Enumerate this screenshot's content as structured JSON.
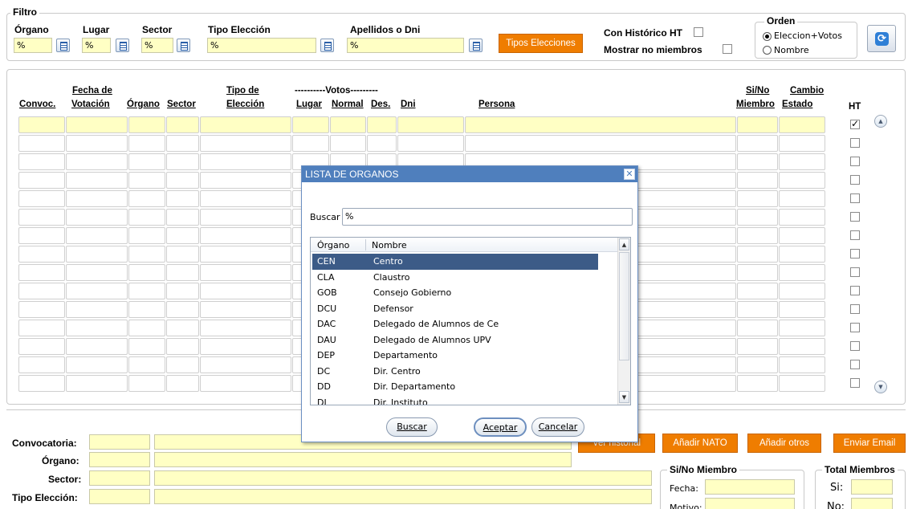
{
  "filter": {
    "legend": "Filtro",
    "organo": {
      "label": "Órgano",
      "value": "%"
    },
    "lugar": {
      "label": "Lugar",
      "value": "%"
    },
    "sector": {
      "label": "Sector",
      "value": "%"
    },
    "tipo_eleccion": {
      "label": "Tipo Elección",
      "value": "%"
    },
    "apellidos": {
      "label": "Apellidos o Dni",
      "value": "%"
    },
    "tipos_button": "Tipos Elecciones",
    "con_historico": "Con Histórico HT",
    "mostrar_no_miembros": "Mostrar no miembros"
  },
  "orden": {
    "legend": "Orden",
    "opt1": "Eleccion+Votos",
    "opt2": "Nombre",
    "selected": "Eleccion+Votos"
  },
  "grid": {
    "headers": {
      "convoc": "Convoc.",
      "fecha_1": "Fecha de",
      "fecha_2": "Votación",
      "organo": "Órgano",
      "sector": "Sector",
      "tipo_1": "Tipo de",
      "tipo_2": "Elección",
      "votos_group": "----------Votos---------",
      "lugar": "Lugar",
      "normal": "Normal",
      "des": "Des.",
      "dni": "Dni",
      "persona": "Persona",
      "sino_1": "Si/No",
      "sino_2": "Miembro",
      "cambio_1": "Cambio",
      "cambio_2": "Estado",
      "ht": "HT"
    },
    "row_count": 15,
    "first_row_ht_checked": true
  },
  "dialog": {
    "title": "LISTA DE ORGANOS",
    "search_label": "Buscar",
    "search_value": "%",
    "col_organo": "Órgano",
    "col_nombre": "Nombre",
    "rows": [
      {
        "code": "CEN",
        "name": "Centro",
        "selected": true
      },
      {
        "code": "CLA",
        "name": "Claustro"
      },
      {
        "code": "GOB",
        "name": "Consejo Gobierno"
      },
      {
        "code": "DCU",
        "name": "Defensor"
      },
      {
        "code": "DAC",
        "name": "Delegado de Alumnos de Ce"
      },
      {
        "code": "DAU",
        "name": "Delegado de Alumnos UPV"
      },
      {
        "code": "DEP",
        "name": "Departamento"
      },
      {
        "code": "DC",
        "name": "Dir. Centro"
      },
      {
        "code": "DD",
        "name": "Dir. Departamento"
      },
      {
        "code": "DI",
        "name": "Dir. Instituto"
      }
    ],
    "btn_buscar": "Buscar",
    "btn_aceptar": "Aceptar",
    "btn_cancelar": "Cancelar"
  },
  "detail": {
    "convocatoria": "Convocatoria:",
    "organo": "Órgano:",
    "sector": "Sector:",
    "tipo_eleccion": "Tipo Elección:",
    "btn_historial": "Ver historial",
    "btn_nato": "Añadir NATO",
    "btn_otros": "Añadir otros",
    "btn_email": "Enviar Email",
    "sino_legend": "Si/No Miembro",
    "fecha": "Fecha:",
    "motivo": "Motivo:",
    "total_legend": "Total Miembros",
    "si": "Si:",
    "no": "No:"
  },
  "colors": {
    "field_yellow": "#ffffc4",
    "orange": "#ef7d00",
    "dialog_blue": "#4f7fbd",
    "selection": "#3c5b87"
  }
}
